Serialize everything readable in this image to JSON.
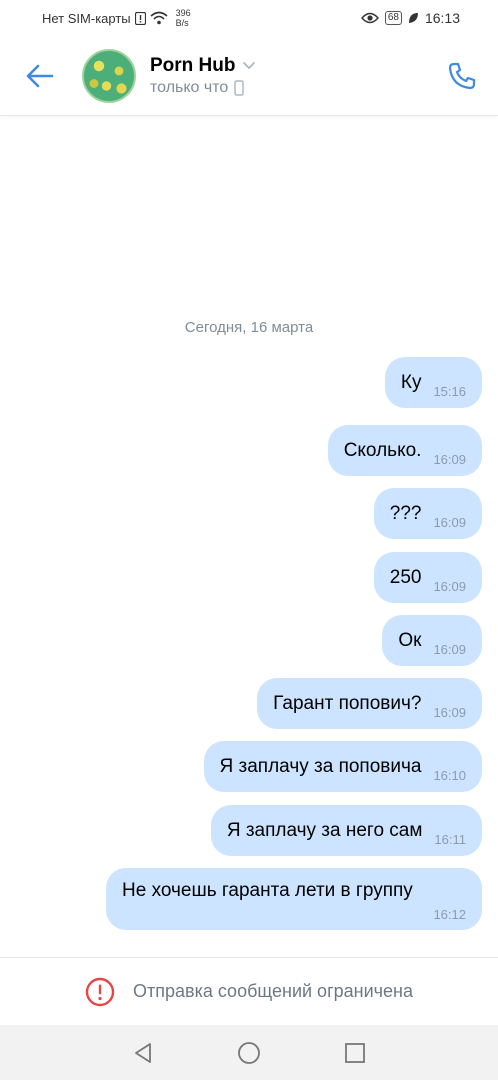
{
  "status_bar": {
    "carrier": "Нет SIM-карты",
    "net_speed_value": "396",
    "net_speed_unit": "B/s",
    "battery": "68",
    "time": "16:13"
  },
  "header": {
    "title": "Porn Hub",
    "subtitle": "только что"
  },
  "date_separator": "Сегодня, 16 марта",
  "messages": [
    {
      "text": "Ку",
      "time": "15:16"
    },
    {
      "text": "Сколько.",
      "time": "16:09"
    },
    {
      "text": "???",
      "time": "16:09"
    },
    {
      "text": "250",
      "time": "16:09"
    },
    {
      "text": "Ок",
      "time": "16:09"
    },
    {
      "text": "Гарант попович?",
      "time": "16:09"
    },
    {
      "text": "Я заплачу за поповича",
      "time": "16:10"
    },
    {
      "text": "Я заплачу за него сам",
      "time": "16:11"
    },
    {
      "text": "Не хочешь гаранта лети в группу",
      "time": "16:12"
    }
  ],
  "footer": {
    "restriction_text": "Отправка сообщений ограничена"
  },
  "colors": {
    "accent": "#3f8ae0",
    "bubble_out": "#cce4ff",
    "warning": "#e64646"
  },
  "icons": {
    "back": "arrow-left-icon",
    "call": "phone-icon",
    "warning": "exclamation-circle-icon",
    "nav_back": "triangle-back-icon",
    "nav_home": "circle-home-icon",
    "nav_recent": "square-recent-icon"
  }
}
